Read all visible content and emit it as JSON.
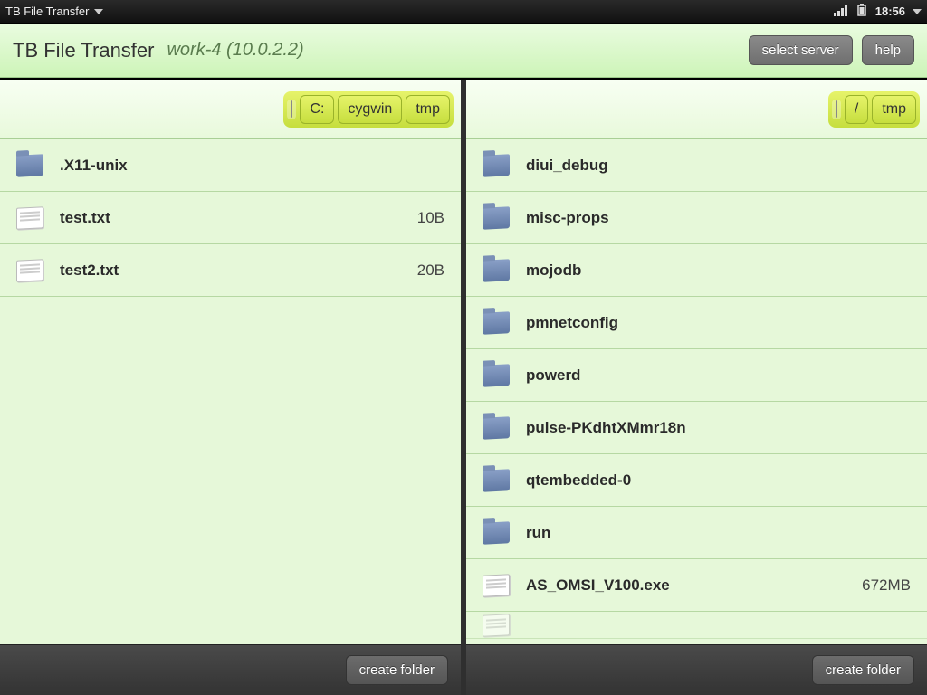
{
  "statusbar": {
    "app_name": "TB File Transfer",
    "time": "18:56"
  },
  "header": {
    "title": "TB File Transfer",
    "subtitle": "work-4 (10.0.2.2)",
    "select_server_label": "select server",
    "help_label": "help"
  },
  "left_pane": {
    "breadcrumbs": [
      "C:",
      "cygwin",
      "tmp"
    ],
    "items": [
      {
        "type": "folder",
        "name": ".X11-unix",
        "size": ""
      },
      {
        "type": "file",
        "name": "test.txt",
        "size": "10B"
      },
      {
        "type": "file",
        "name": "test2.txt",
        "size": "20B"
      }
    ],
    "create_folder_label": "create folder"
  },
  "right_pane": {
    "breadcrumbs": [
      "/",
      "tmp"
    ],
    "items": [
      {
        "type": "folder",
        "name": "diui_debug",
        "size": ""
      },
      {
        "type": "folder",
        "name": "misc-props",
        "size": ""
      },
      {
        "type": "folder",
        "name": "mojodb",
        "size": ""
      },
      {
        "type": "folder",
        "name": "pmnetconfig",
        "size": ""
      },
      {
        "type": "folder",
        "name": "powerd",
        "size": ""
      },
      {
        "type": "folder",
        "name": "pulse-PKdhtXMmr18n",
        "size": ""
      },
      {
        "type": "folder",
        "name": "qtembedded-0",
        "size": ""
      },
      {
        "type": "folder",
        "name": "run",
        "size": ""
      },
      {
        "type": "file",
        "name": "AS_OMSI_V100.exe",
        "size": "672MB"
      }
    ],
    "create_folder_label": "create folder"
  }
}
